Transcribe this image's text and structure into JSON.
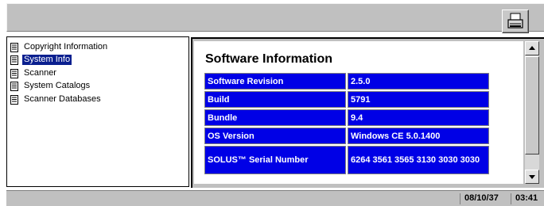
{
  "tree": {
    "items": [
      {
        "label": "Copyright Information",
        "selected": false
      },
      {
        "label": "System Info",
        "selected": true
      },
      {
        "label": "Scanner",
        "selected": false
      },
      {
        "label": "System Catalogs",
        "selected": false
      },
      {
        "label": "Scanner Databases",
        "selected": false
      }
    ]
  },
  "content": {
    "title": "Software Information",
    "rows": [
      {
        "key": "Software Revision",
        "value": "2.5.0"
      },
      {
        "key": "Build",
        "value": "5791"
      },
      {
        "key": "Bundle",
        "value": "9.4"
      },
      {
        "key": "OS Version",
        "value": "Windows CE 5.0.1400"
      },
      {
        "key": "SOLUS™ Serial Number",
        "value": "6264 3561 3565 3130 3030 3030"
      }
    ]
  },
  "status": {
    "date": "08/10/37",
    "time": "03:41"
  },
  "colors": {
    "cell_bg": "#0000e6",
    "selection": "#0a1f8f",
    "chrome": "#c0c0c0"
  },
  "icons": {
    "print": "printer-icon",
    "tree_item": "document-icon",
    "scroll_up": "arrow-up-icon",
    "scroll_down": "arrow-down-icon"
  }
}
